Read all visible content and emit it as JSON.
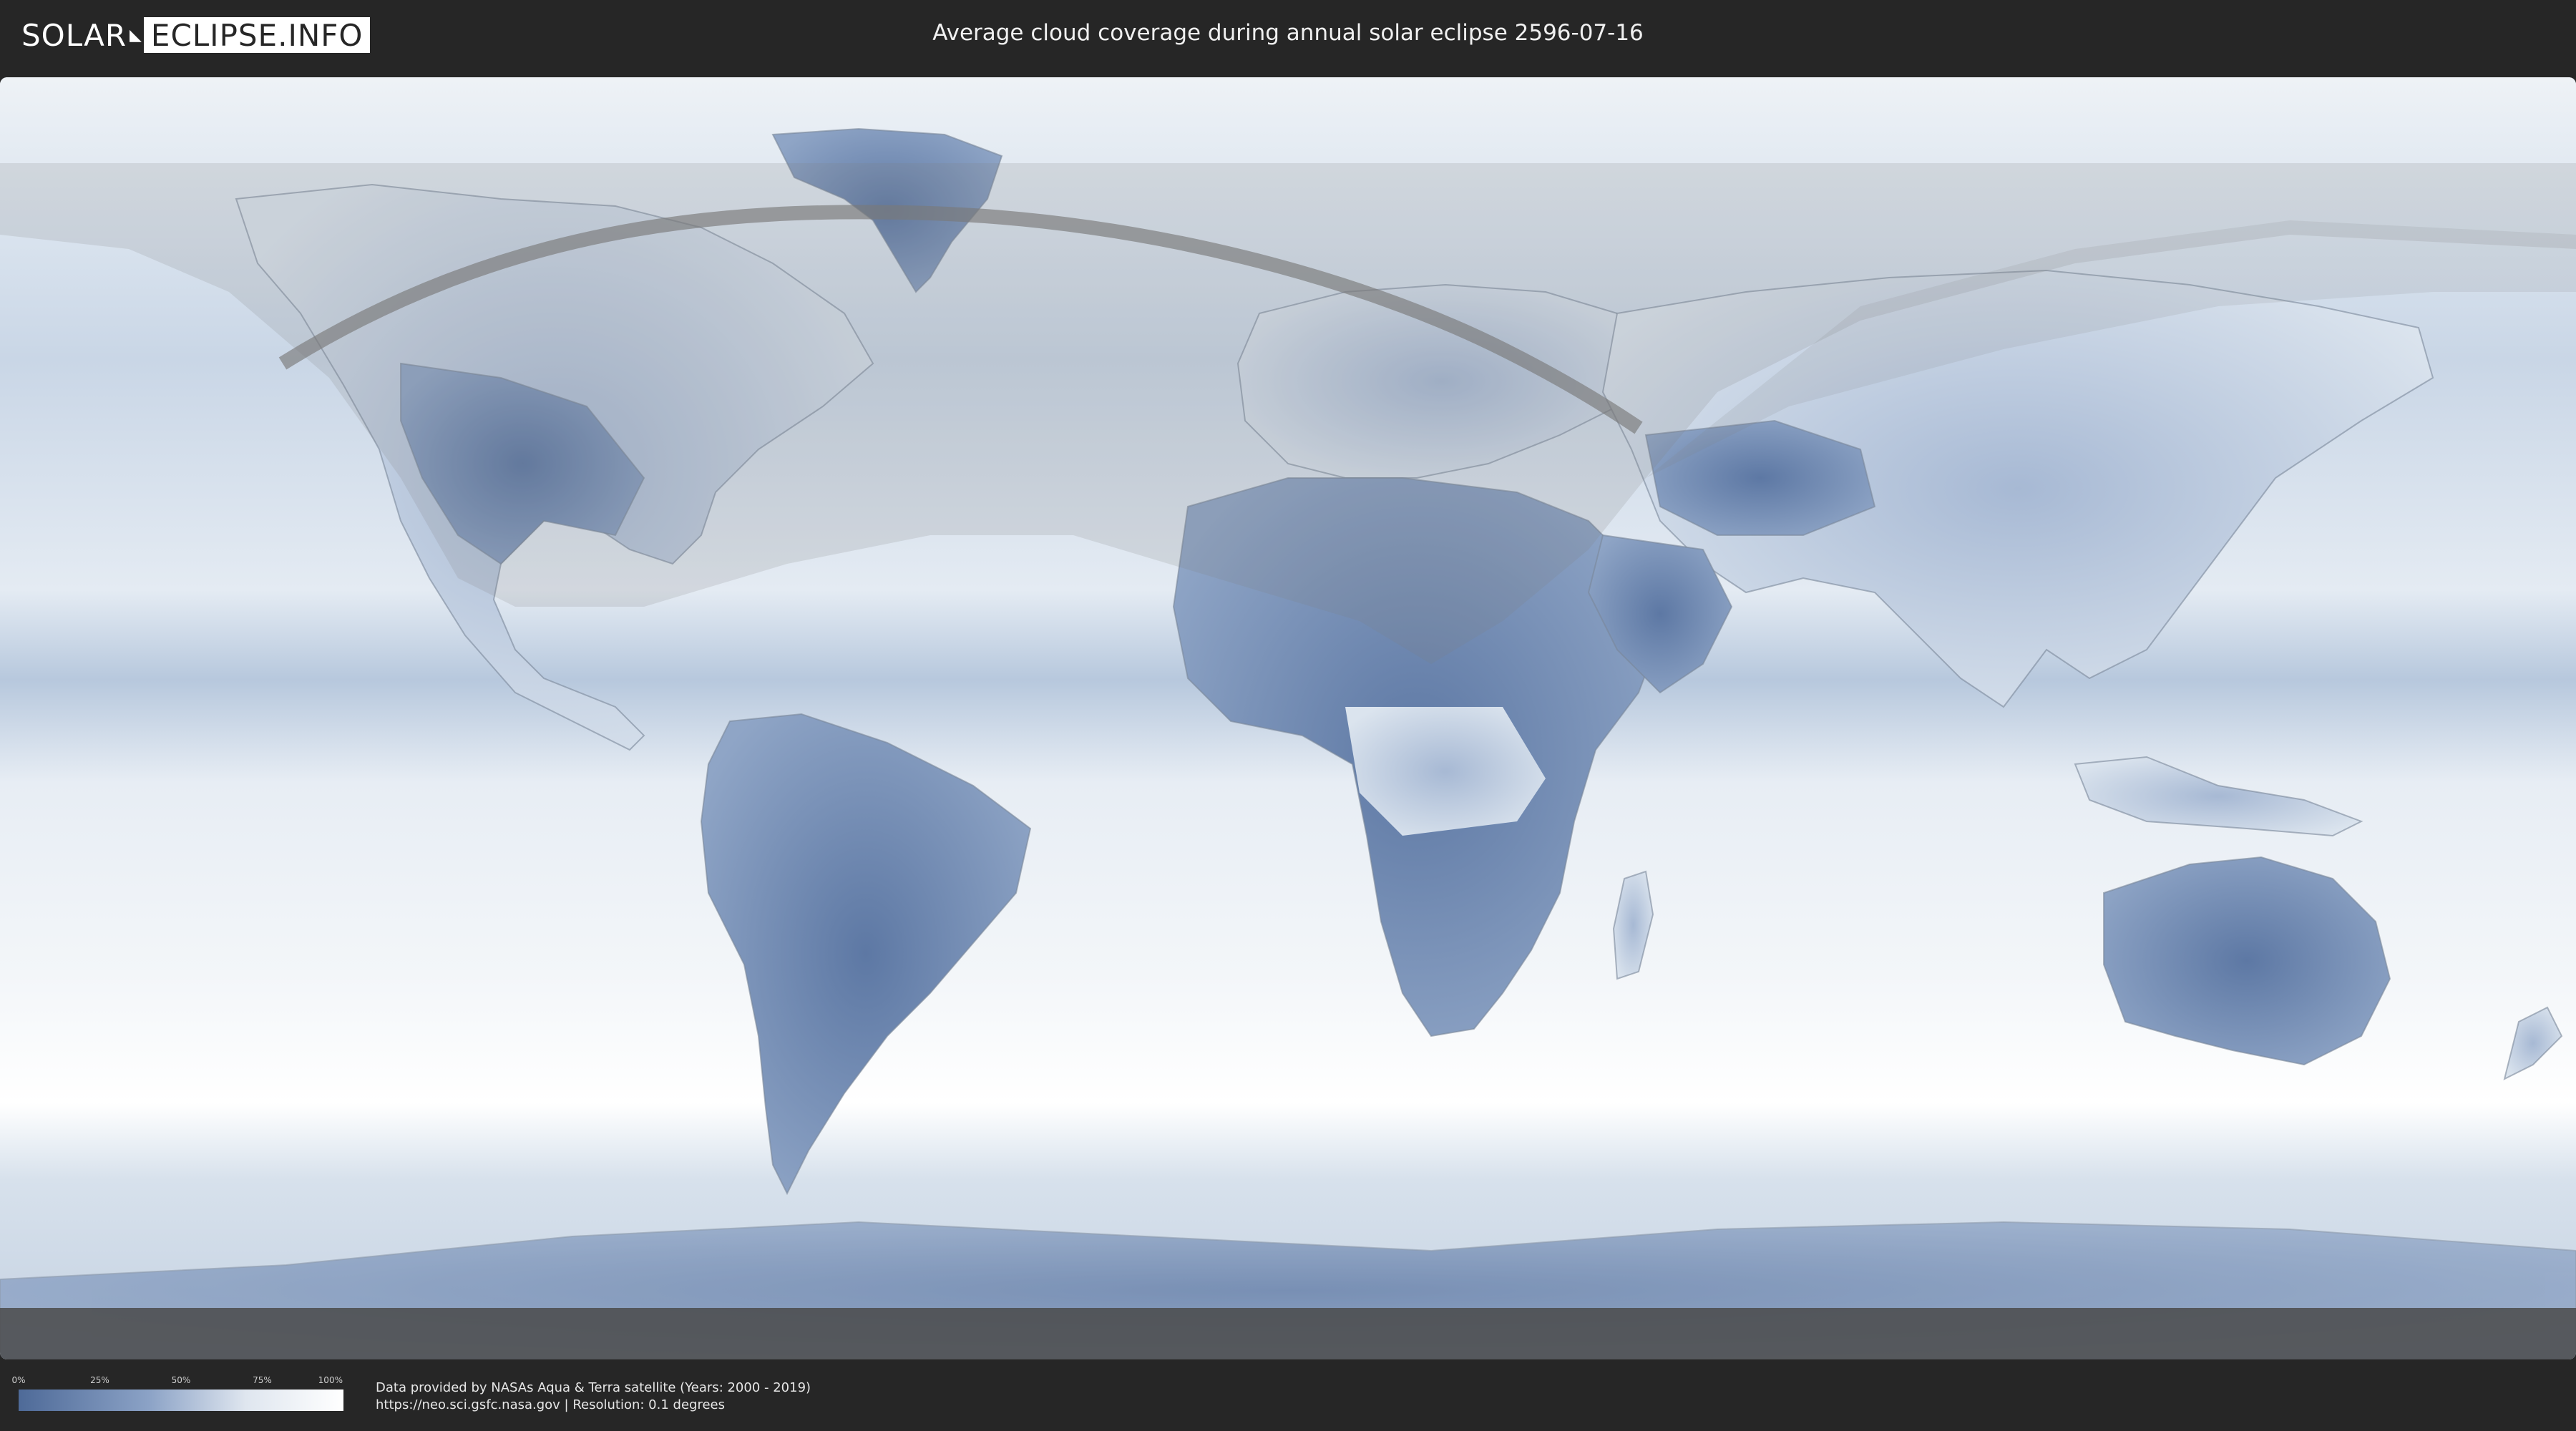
{
  "header": {
    "logo_solar": "SOLAR",
    "logo_rest": "ECLIPSE.INFO",
    "title": "Average cloud coverage during annual solar eclipse 2596-07-16"
  },
  "map": {
    "ocean_color": "#e3ebf3",
    "cloud_low_color": "#4e6a98",
    "cloud_high_color": "#ffffff",
    "eclipse_band_color": "#7a7a7a"
  },
  "legend": {
    "ticks": [
      "0%",
      "25%",
      "50%",
      "75%",
      "100%"
    ],
    "tick_values": [
      0,
      25,
      50,
      75,
      100
    ]
  },
  "credit": {
    "line1": "Data provided by NASAs Aqua & Terra satellite (Years: 2000 - 2019)",
    "line2": "https://neo.sci.gsfc.nasa.gov | Resolution: 0.1 degrees"
  }
}
